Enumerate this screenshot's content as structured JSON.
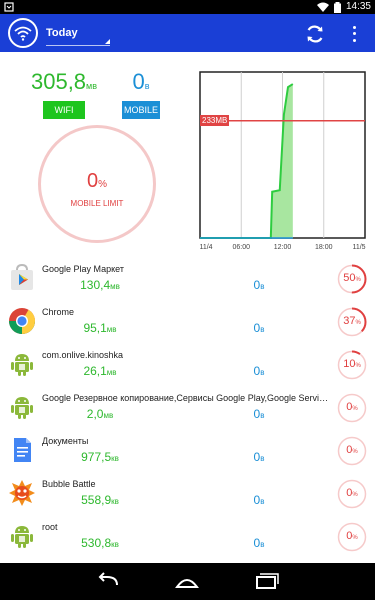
{
  "status_bar": {
    "time": "14:35"
  },
  "header": {
    "period": "Today"
  },
  "summary": {
    "wifi": {
      "value": "305,8",
      "unit": "мв",
      "tag": "WIFI"
    },
    "mobile": {
      "value": "0",
      "unit": "в",
      "tag": "MOBILE"
    },
    "limit": {
      "percent": "0",
      "unit": "%",
      "label": "MOBILE LIMIT"
    }
  },
  "chart": {
    "limit_label": "233MB",
    "x_ticks": [
      "11/4",
      "06:00",
      "12:00",
      "18:00",
      "11/5"
    ]
  },
  "chart_data": {
    "type": "area",
    "x": [
      "11/4 00:00",
      "11/4 06:00",
      "11/4 12:00",
      "11/4 18:00",
      "11/5 00:00"
    ],
    "x_ticks": [
      "11/4",
      "06:00",
      "12:00",
      "18:00",
      "11/5"
    ],
    "series": [
      {
        "color": "#2ecc40",
        "points": [
          {
            "x": 0,
            "y": 0
          },
          {
            "x": 9,
            "y": 0
          },
          {
            "x": 10.3,
            "y": 0
          },
          {
            "x": 10.5,
            "y": 92
          },
          {
            "x": 11.6,
            "y": 95
          },
          {
            "x": 12.2,
            "y": 245
          },
          {
            "x": 12.8,
            "y": 300
          },
          {
            "x": 13.5,
            "y": 306
          }
        ]
      }
    ],
    "limit_line": {
      "value": 233,
      "label": "233MB",
      "color": "#e04444"
    },
    "ylim": [
      0,
      330
    ],
    "xlim_hours": [
      0,
      24
    ]
  },
  "apps": [
    {
      "name": "Google Play Маркет",
      "wifi": "130,4",
      "wifi_unit": "мв",
      "mobile": "0",
      "mobile_unit": "в",
      "percent": "50",
      "fraction": 0.5,
      "icon": "google-play-icon"
    },
    {
      "name": "Chrome",
      "wifi": "95,1",
      "wifi_unit": "мв",
      "mobile": "0",
      "mobile_unit": "в",
      "percent": "37",
      "fraction": 0.37,
      "icon": "chrome-icon"
    },
    {
      "name": "com.onlive.kinoshka",
      "wifi": "26,1",
      "wifi_unit": "мв",
      "mobile": "0",
      "mobile_unit": "в",
      "percent": "10",
      "fraction": 0.1,
      "icon": "android-icon"
    },
    {
      "name": "Google Резервное копирование,Сервисы Google Play,Google Services Framework",
      "wifi": "2,0",
      "wifi_unit": "мв",
      "mobile": "0",
      "mobile_unit": "в",
      "percent": "0",
      "fraction": 0,
      "icon": "android-icon"
    },
    {
      "name": "Документы",
      "wifi": "977,5",
      "wifi_unit": "кв",
      "mobile": "0",
      "mobile_unit": "в",
      "percent": "0",
      "fraction": 0,
      "icon": "documents-icon"
    },
    {
      "name": "Bubble Battle",
      "wifi": "558,9",
      "wifi_unit": "кв",
      "mobile": "0",
      "mobile_unit": "в",
      "percent": "0",
      "fraction": 0,
      "icon": "bubble-battle-icon"
    },
    {
      "name": "root",
      "wifi": "530,8",
      "wifi_unit": "кв",
      "mobile": "0",
      "mobile_unit": "в",
      "percent": "0",
      "fraction": 0,
      "icon": "android-icon"
    }
  ],
  "colors": {
    "app_bar": "#1a3fd6",
    "wifi": "#2eb82e",
    "mobile": "#1b8fd6",
    "limit": "#e04040"
  }
}
